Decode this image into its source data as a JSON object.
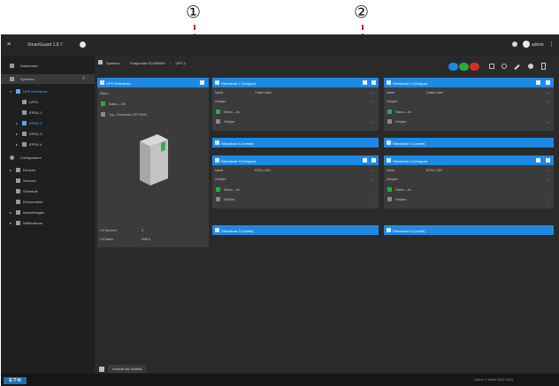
{
  "callouts": [
    "①",
    "②"
  ],
  "title_bar": {
    "app_name": "SmartGuard 1.8.7",
    "user": "admin"
  },
  "sidebar": {
    "dashboard": "Dashboard",
    "systems": "Systems",
    "tree": [
      "UPS Enterprise",
      "UPS1",
      "EPDU 1",
      "EPDU 2",
      "EPDU 3",
      "EPDU 4"
    ],
    "configuration": "Configuration",
    "config_items": [
      "Devices",
      "Sensors",
      "Schedule",
      "Environment",
      "Assemblages",
      "Notifications"
    ]
  },
  "breadcrumb": {
    "items": [
      "Systems",
      "Endpunkte SCHRANK",
      "UPS 1"
    ]
  },
  "device_panel": {
    "title": "UPS Enterprise",
    "rows": [
      "Status",
      "Status – OK",
      "Typ – Enterprise UPS 5KVA"
    ],
    "footer_labels": [
      "Ort Nummer",
      "Ort Name"
    ],
    "footer_values": [
      "3",
      "EMEA"
    ]
  },
  "outlet_panels": [
    {
      "title": "Steckdose 1 (Gruppe)",
      "rows": [
        "Name",
        "Zeitplan",
        "Status – An",
        "Zeitplan"
      ],
      "name_value": "Outlet Label"
    },
    {
      "title": "Steckdose 2 (Gruppe)",
      "rows": [
        "Name",
        "Zeitplan",
        "Status – An",
        "Zeitplan"
      ],
      "name_value": "Outlet Label"
    },
    {
      "title": "Steckdose 3 (Gruppe)",
      "rows": [
        "Name",
        "Zeitplan",
        "Status – An",
        "Zeitplan"
      ],
      "name_value": "EPDU 1/B1"
    },
    {
      "title": "Steckdose 4 (Gruppe)",
      "rows": [
        "Name",
        "Zeitplan",
        "Status – An",
        "Zeitplan"
      ],
      "name_value": "EPDU 1/B2"
    }
  ],
  "line_bars": [
    "Steckdose 1 (Leiste)",
    "Steckdose 2 (Leiste)",
    "Steckdose 3 (Leiste)",
    "Steckdose 4 (Leiste)"
  ],
  "bottom_button": "Ansicht als Vollbild",
  "status_bar": {
    "brand": "E·T·N",
    "right_text": "Lizenz: © Eaton 2023 / 2024"
  },
  "colors": {
    "accent": "#1e88e5",
    "status_ok": "#27ae3f",
    "callout_arrow": "#e0231f"
  }
}
